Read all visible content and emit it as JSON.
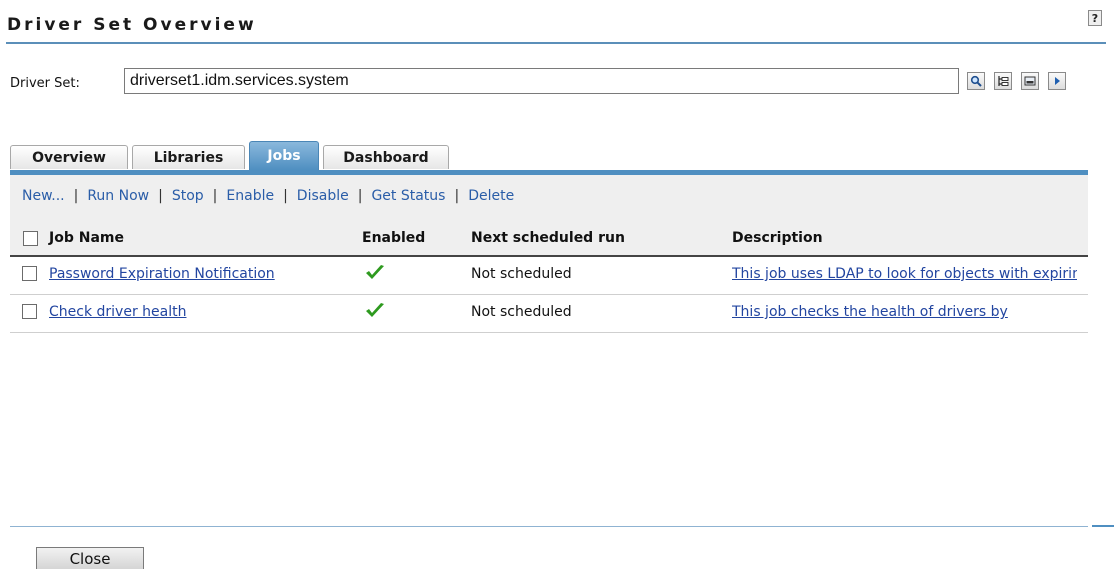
{
  "header": {
    "title": "Driver Set Overview",
    "help_label": "?"
  },
  "driver_set": {
    "label": "Driver Set:",
    "value": "driverset1.idm.services.system"
  },
  "toolbar_icons": [
    "search-icon",
    "tree-browse-icon",
    "history-icon",
    "arrow-right-icon"
  ],
  "tabs": [
    {
      "label": "Overview"
    },
    {
      "label": "Libraries"
    },
    {
      "label": "Jobs"
    },
    {
      "label": "Dashboard"
    }
  ],
  "active_tab": "Jobs",
  "actions": [
    "New...",
    "Run Now",
    "Stop",
    "Enable",
    "Disable",
    "Get Status",
    "Delete"
  ],
  "table": {
    "columns": [
      "Job Name",
      "Enabled",
      "Next scheduled run",
      "Description"
    ],
    "rows": [
      {
        "name": "Password Expiration Notification",
        "enabled": true,
        "next_run": "Not scheduled",
        "description": "This job uses LDAP to look for objects with expiring passwords"
      },
      {
        "name": "Check driver health",
        "enabled": true,
        "next_run": "Not scheduled",
        "description": "This job checks the health of drivers by"
      }
    ]
  },
  "footer": {
    "close_label": "Close"
  },
  "colors": {
    "accent": "#4f8fc1",
    "link": "#2245a0",
    "check": "#2e9a1f"
  }
}
